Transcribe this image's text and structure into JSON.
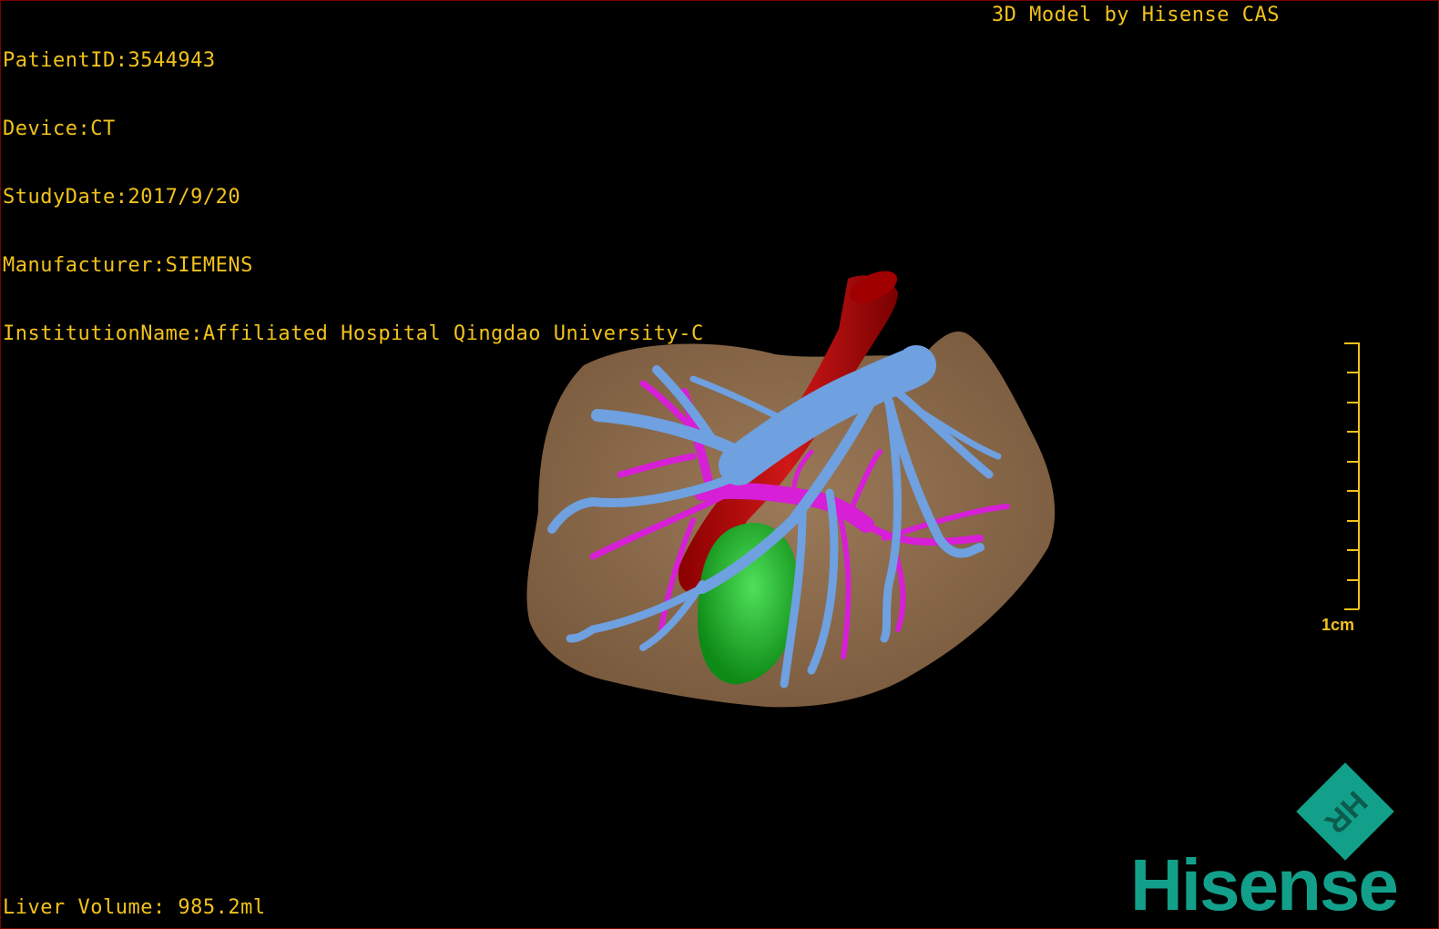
{
  "overlay": {
    "patient_id": "PatientID:3544943",
    "device": "Device:CT",
    "study_date": "StudyDate:2017/9/20",
    "manufacturer": "Manufacturer:SIEMENS",
    "institution": "InstitutionName:Affiliated Hospital Qingdao University-C",
    "title": "3D Model by Hisense CAS",
    "liver_volume": "Liver Volume: 985.2ml"
  },
  "scale_bar": {
    "label": "1cm"
  },
  "brand": {
    "name": "Hisense",
    "logo_letters": "HR",
    "color": "#13a08a"
  },
  "model_colors": {
    "liver": "#8b6a4b",
    "hepatic_vein": "#6fa0e0",
    "portal_vein": "#d020d0",
    "artery": "#b81010",
    "gallbladder": "#1fbf2a"
  }
}
